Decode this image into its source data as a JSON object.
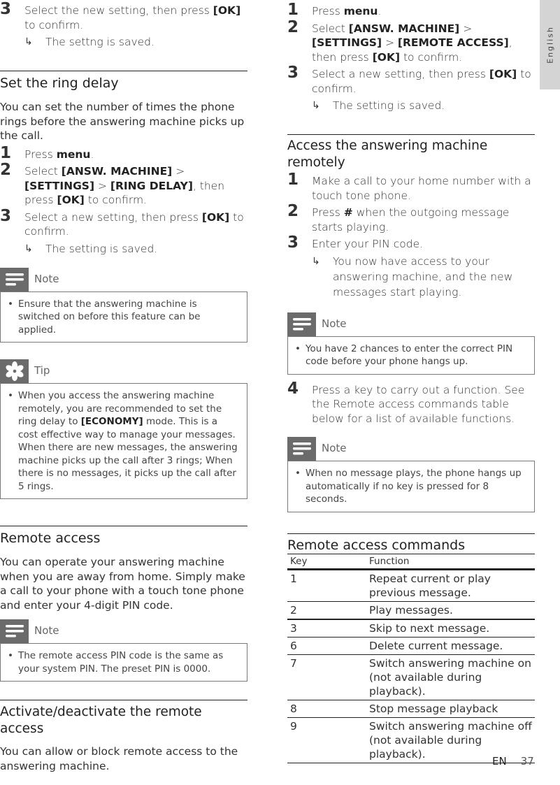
{
  "language_tab": "English",
  "footer": {
    "lang": "EN",
    "page": "37"
  },
  "left": {
    "top_step": {
      "num": "3",
      "text_pre": "Select the new setting, then press ",
      "key": "[OK]",
      "text_post": " to confirm.",
      "result": "The settng is saved."
    },
    "ring_delay": {
      "title": "Set the ring delay",
      "intro": "You can set the number of times the phone rings before the answering machine picks up the call.",
      "steps": [
        {
          "num": "1",
          "pre": "Press ",
          "bold": "menu",
          "post": "."
        },
        {
          "num": "2",
          "pre": "Select ",
          "b1": "[ANSW. MACHINE]",
          "sep1": " > ",
          "b2": "[SETTINGS]",
          "sep2": " > ",
          "b3": "[RING DELAY]",
          "mid": ", then press ",
          "b4": "[OK]",
          "post": " to confirm."
        },
        {
          "num": "3",
          "pre": "Select a new setting, then press ",
          "bold": "[OK]",
          "post": " to confirm.",
          "result": "The setting is saved."
        }
      ],
      "note": {
        "label": "Note",
        "text": "Ensure that the answering machine is switched on before this feature can be applied."
      },
      "tip": {
        "label": "Tip",
        "pre": "When you access the answering machine remotely, you are recommended to set the ring delay to ",
        "bold": "[ECONOMY]",
        "post": " mode. This is a cost effective way to manage your messages. When there are new messages, the answering machine picks up the call after 3 rings; When there is no messages, it picks up the call after 5 rings."
      }
    },
    "remote_access": {
      "title": "Remote access",
      "intro": "You can operate your answering machine when you are away from home. Simply make a call to your phone with a touch tone phone and enter your 4-digit PIN code.",
      "note": {
        "label": "Note",
        "text": "The remote access PIN code is the same as your system PIN. The preset PIN is 0000."
      }
    },
    "activate": {
      "title": "Activate/deactivate the remote access",
      "intro": "You can allow or block remote access to the answering machine."
    }
  },
  "right": {
    "steps": [
      {
        "num": "1",
        "pre": "Press ",
        "bold": "menu",
        "post": "."
      },
      {
        "num": "2",
        "pre": "Select ",
        "b1": "[ANSW. MACHINE]",
        "sep1": " > ",
        "b2": "[SETTINGS]",
        "sep2": " > ",
        "b3": "[REMOTE ACCESS]",
        "mid": ", then press ",
        "b4": "[OK]",
        "post": " to confirm."
      },
      {
        "num": "3",
        "pre": "Select a new setting, then press ",
        "bold": "[OK]",
        "post": " to confirm.",
        "result": "The setting is saved."
      }
    ],
    "access_remotely": {
      "title": "Access the answering machine remotely",
      "steps": [
        {
          "num": "1",
          "text": "Make a call to your home number with a touch tone phone."
        },
        {
          "num": "2",
          "pre": "Press ",
          "icon": "#",
          "post": " when the outgoing message starts playing."
        },
        {
          "num": "3",
          "text": "Enter your PIN code.",
          "result": "You now have access to your answering machine, and the new messages start playing."
        },
        {
          "num": "4",
          "text": "Press a key to carry out a function. See the Remote access commands table below for a list of available functions."
        }
      ],
      "note1": {
        "label": "Note",
        "text": "You have 2 chances to enter the correct PIN code before your phone hangs up."
      },
      "note2": {
        "label": "Note",
        "text": "When no message plays, the phone hangs up automatically if no key is pressed for 8 seconds."
      }
    },
    "commands": {
      "title": "Remote access commands",
      "headers": [
        "Key",
        "Function"
      ],
      "rows": [
        {
          "key": "1",
          "fn": "Repeat current or play previous message."
        },
        {
          "key": "2",
          "fn": "Play messages."
        },
        {
          "key": "3",
          "fn": "Skip to next message."
        },
        {
          "key": "6",
          "fn": "Delete current message."
        },
        {
          "key": "7",
          "fn": "Switch answering machine on (not available during playback)."
        },
        {
          "key": "8",
          "fn": "Stop message playback"
        },
        {
          "key": "9",
          "fn": "Switch answering machine off (not available during playback)."
        }
      ]
    }
  }
}
